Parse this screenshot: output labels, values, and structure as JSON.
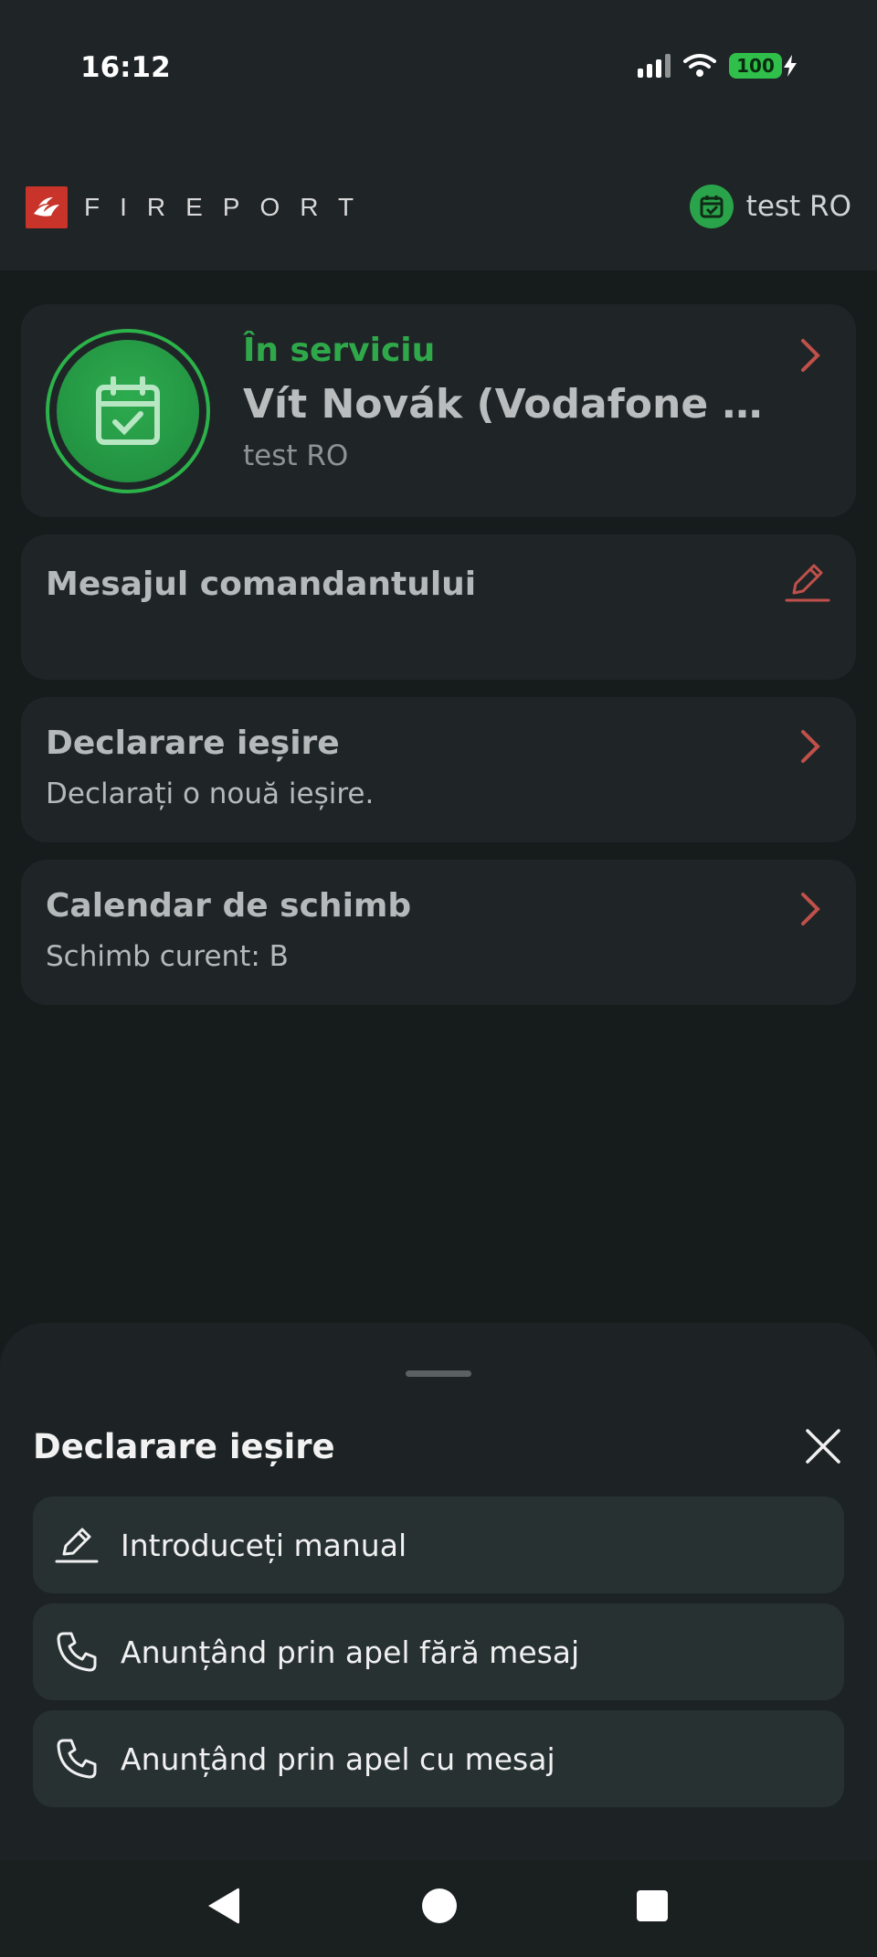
{
  "status_bar": {
    "time": "16:12",
    "battery": "100"
  },
  "header": {
    "logo_text": "FIREPORT",
    "user_name": "test RO"
  },
  "service_card": {
    "status": "În serviciu",
    "name": "Vít Novák (Vodafone C...",
    "unit": "test RO"
  },
  "commander_card": {
    "title": "Mesajul comandantului"
  },
  "exit_card": {
    "title": "Declarare ieșire",
    "subtitle": "Declarați o nouă ieșire."
  },
  "shift_card": {
    "title": "Calendar de schimb",
    "subtitle": "Schimb curent: B"
  },
  "sheet": {
    "title": "Declarare ieșire",
    "options": [
      {
        "label": "Introduceți manual",
        "icon": "pencil-icon"
      },
      {
        "label": "Anunțând prin apel fără mesaj",
        "icon": "phone-icon"
      },
      {
        "label": "Anunțând prin apel cu mesaj",
        "icon": "phone-icon"
      }
    ]
  },
  "colors": {
    "accent_green": "#2fa84a",
    "accent_red": "#c8332a",
    "chevron": "#c0504a"
  }
}
